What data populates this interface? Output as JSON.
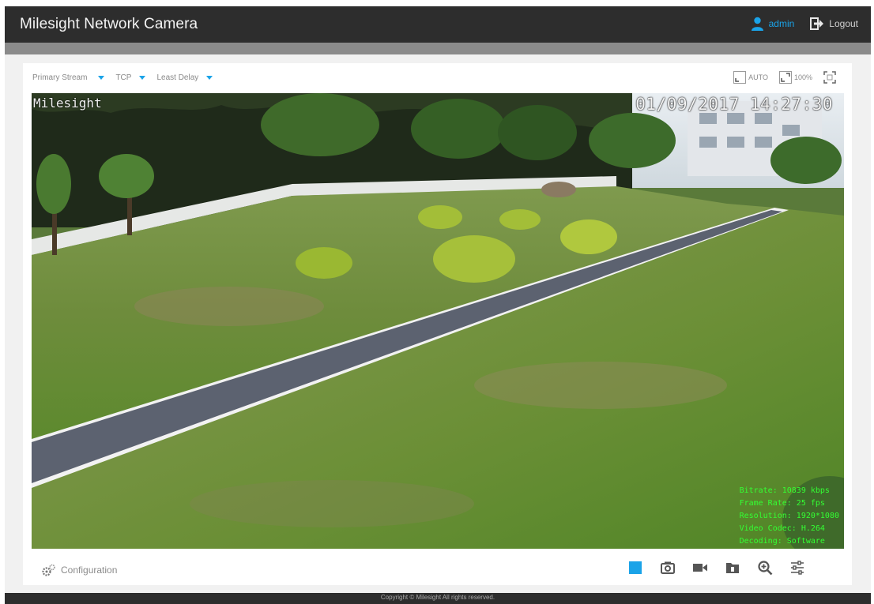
{
  "app": {
    "title": "Milesight Network Camera",
    "user": "admin",
    "logout_label": "Logout",
    "accent": "#1aa3e8"
  },
  "toolbar": {
    "stream": "Primary Stream",
    "protocol": "TCP",
    "delay_mode": "Least Delay",
    "view_modes": [
      {
        "icon": "fit-auto-icon",
        "label": "AUTO"
      },
      {
        "icon": "actual-size-icon",
        "label": "100%"
      },
      {
        "icon": "fullscreen-icon",
        "label": ""
      }
    ]
  },
  "video": {
    "osd_name": "Milesight",
    "osd_datetime": "01/09/2017 14:27:30",
    "osd_info": [
      "Bitrate: 10839 kbps",
      "Frame Rate: 25 fps",
      "Resolution: 1920*1080",
      "Video Codec: H.264",
      "Decoding: Software"
    ]
  },
  "bottom": {
    "configuration_label": "Configuration",
    "tools": [
      {
        "icon": "stop-icon",
        "color": "#1aa3e8"
      },
      {
        "icon": "snapshot-icon"
      },
      {
        "icon": "record-icon"
      },
      {
        "icon": "folder-icon"
      },
      {
        "icon": "zoom-icon"
      },
      {
        "icon": "settings-sliders-icon"
      }
    ]
  },
  "footer": {
    "copyright": "Copyright © Milesight All rights reserved."
  }
}
